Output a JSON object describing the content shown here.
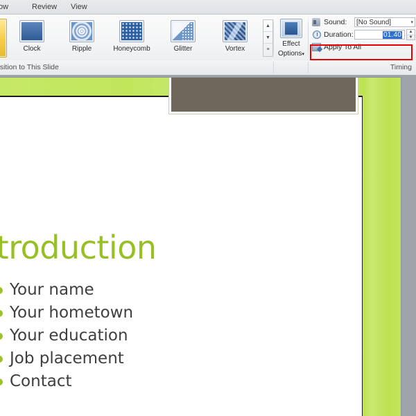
{
  "app": {
    "tabs": [
      {
        "label": "ow",
        "name": "tab-slide-show"
      },
      {
        "label": "Review",
        "name": "tab-review"
      },
      {
        "label": "View",
        "name": "tab-view"
      }
    ]
  },
  "ribbon": {
    "transition_group_label": "nsition to This Slide",
    "timing_group_label": "Timing",
    "transitions": [
      {
        "label": "Clock",
        "icon": "clock-transition-icon"
      },
      {
        "label": "Ripple",
        "icon": "ripple-transition-icon"
      },
      {
        "label": "Honeycomb",
        "icon": "honeycomb-transition-icon"
      },
      {
        "label": "Glitter",
        "icon": "glitter-transition-icon"
      },
      {
        "label": "Vortex",
        "icon": "vortex-transition-icon"
      }
    ],
    "gallery_scroll": {
      "up": "▲",
      "down": "▼",
      "more": "≡"
    },
    "effect_options": {
      "label": "Effect",
      "label2": "Options",
      "caret": "▾",
      "icon": "effect-options-icon"
    },
    "timing": {
      "sound_label": "Sound:",
      "sound_value": "[No Sound]",
      "sound_caret": "▾",
      "sound_icon": "sound-icon",
      "duration_label": "Duration:",
      "duration_value": "01.40",
      "duration_icon": "clock-icon",
      "spinner_up": "▲",
      "spinner_down": "▼",
      "apply_to_all_label": "Apply To All",
      "apply_to_all_icon": "apply-to-all-icon"
    }
  },
  "annotation": {
    "color": "#e60000",
    "target": "duration-field"
  },
  "slide": {
    "title": "ntroduction",
    "title_color": "#97c024",
    "accent_green": "#c1e65a",
    "shape_brown": "#6f675a",
    "bullets": [
      "Your name",
      "Your hometown",
      "Your education",
      "Job placement",
      "Contact"
    ]
  }
}
